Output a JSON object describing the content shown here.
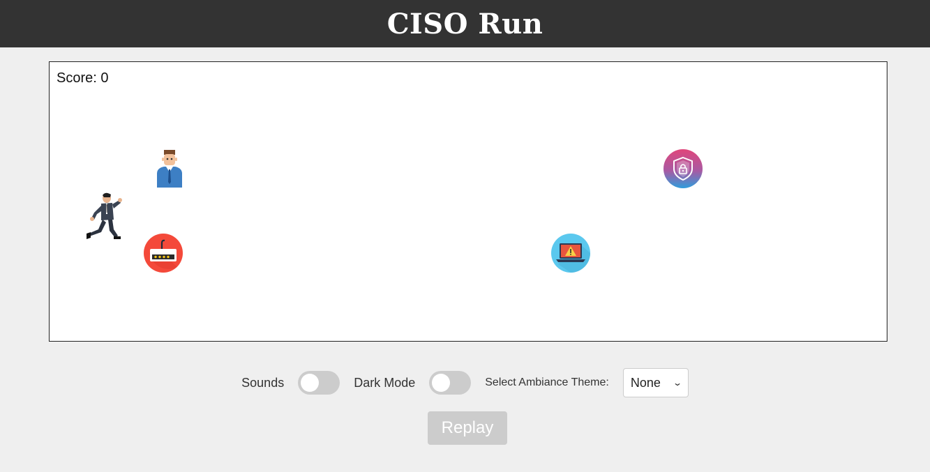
{
  "app": {
    "title": "CISO Run"
  },
  "game": {
    "score_label": "Score: 0",
    "sprites": [
      {
        "name": "ciso-player",
        "icon": "running-businessman-icon"
      },
      {
        "name": "colleague",
        "icon": "businessman-icon"
      },
      {
        "name": "password-router-threat",
        "icon": "router-password-icon",
        "color": "#f4493a"
      },
      {
        "name": "laptop-alert-threat",
        "icon": "laptop-warning-icon",
        "color": "#5bc8ee"
      },
      {
        "name": "security-shield-powerup",
        "icon": "shield-lock-icon",
        "color": "#d8457a"
      }
    ]
  },
  "controls": {
    "sounds_label": "Sounds",
    "sounds_on": false,
    "dark_mode_label": "Dark Mode",
    "dark_mode_on": false,
    "theme_label": "Select Ambiance Theme:",
    "theme_value": "None",
    "replay_label": "Replay"
  },
  "colors": {
    "header_bg": "#333333",
    "page_bg": "#efefef",
    "toggle_off": "#cccccc",
    "button_disabled": "#cccccc"
  }
}
